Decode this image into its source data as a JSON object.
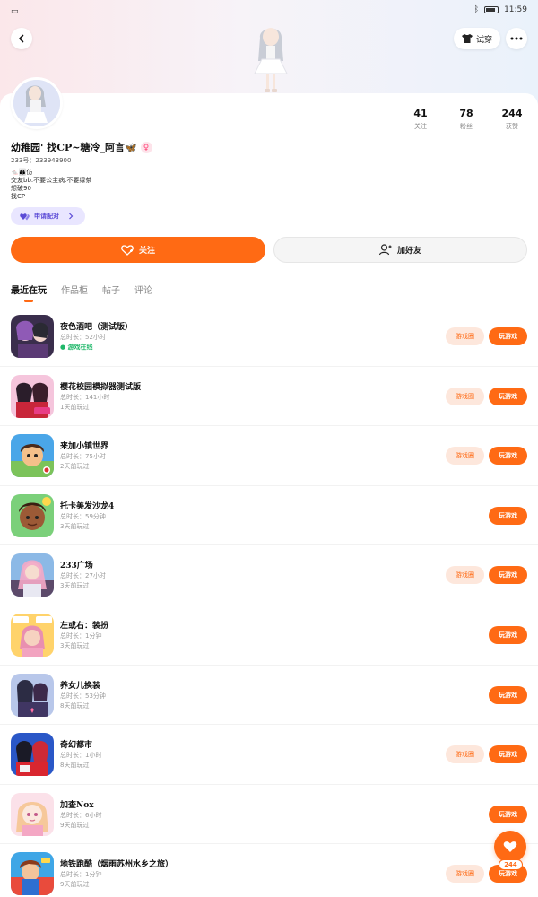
{
  "status_bar": {
    "time": "11:59"
  },
  "header": {
    "try_on_label": "试穿",
    "icons": {
      "back": "back-icon",
      "more": "more-icon",
      "shirt": "shirt-icon"
    }
  },
  "profile": {
    "nickname": "幼稚园' 找CP~糖冷_阿言🦋",
    "uid": "233号：233943900",
    "bio_lines": [
      "🐁👪仿",
      "交友bb.不要公主病.不要绿茶",
      "想破90",
      "找CP"
    ],
    "apply_cp_label": "申请配对",
    "stats": [
      {
        "value": "41",
        "label": "关注"
      },
      {
        "value": "78",
        "label": "粉丝"
      },
      {
        "value": "244",
        "label": "获赞"
      }
    ]
  },
  "actions": {
    "follow_label": "关注",
    "add_friend_label": "加好友"
  },
  "tabs": [
    {
      "label": "最近在玩",
      "active": true
    },
    {
      "label": "作品柜",
      "active": false
    },
    {
      "label": "帖子",
      "active": false
    },
    {
      "label": "评论",
      "active": false
    }
  ],
  "games": [
    {
      "title": "夜色酒吧（测试版）",
      "duration": "总时长：52小时",
      "last": "游戏在线",
      "online": true,
      "has_circle": true
    },
    {
      "title": "樱花校园模拟器测试版",
      "duration": "总时长：141小时",
      "last": "1天前玩过",
      "online": false,
      "has_circle": true
    },
    {
      "title": "来加小镇世界",
      "duration": "总时长：75小时",
      "last": "2天前玩过",
      "online": false,
      "has_circle": true
    },
    {
      "title": "托卡美发沙龙4",
      "duration": "总时长：59分钟",
      "last": "3天前玩过",
      "online": false,
      "has_circle": false
    },
    {
      "title": "233广场",
      "duration": "总时长：27小时",
      "last": "3天前玩过",
      "online": false,
      "has_circle": true
    },
    {
      "title": "左或右：装扮",
      "duration": "总时长：1分钟",
      "last": "3天前玩过",
      "online": false,
      "has_circle": false
    },
    {
      "title": "养女儿换装",
      "duration": "总时长：53分钟",
      "last": "8天前玩过",
      "online": false,
      "has_circle": false
    },
    {
      "title": "奇幻都市",
      "duration": "总时长：1小时",
      "last": "8天前玩过",
      "online": false,
      "has_circle": true
    },
    {
      "title": "加查Nox",
      "duration": "总时长：6小时",
      "last": "9天前玩过",
      "online": false,
      "has_circle": false
    },
    {
      "title": "地铁跑酷（烟雨苏州水乡之旅）",
      "duration": "总时长：1分钟",
      "last": "9天前玩过",
      "online": false,
      "has_circle": true
    }
  ],
  "game_buttons": {
    "circle_label": "游戏圈",
    "play_label": "玩游戏"
  },
  "fab": {
    "count": "244"
  },
  "colors": {
    "accent": "#ff6a14",
    "online": "#20b86a",
    "cp_purple": "#5b4bd6"
  }
}
